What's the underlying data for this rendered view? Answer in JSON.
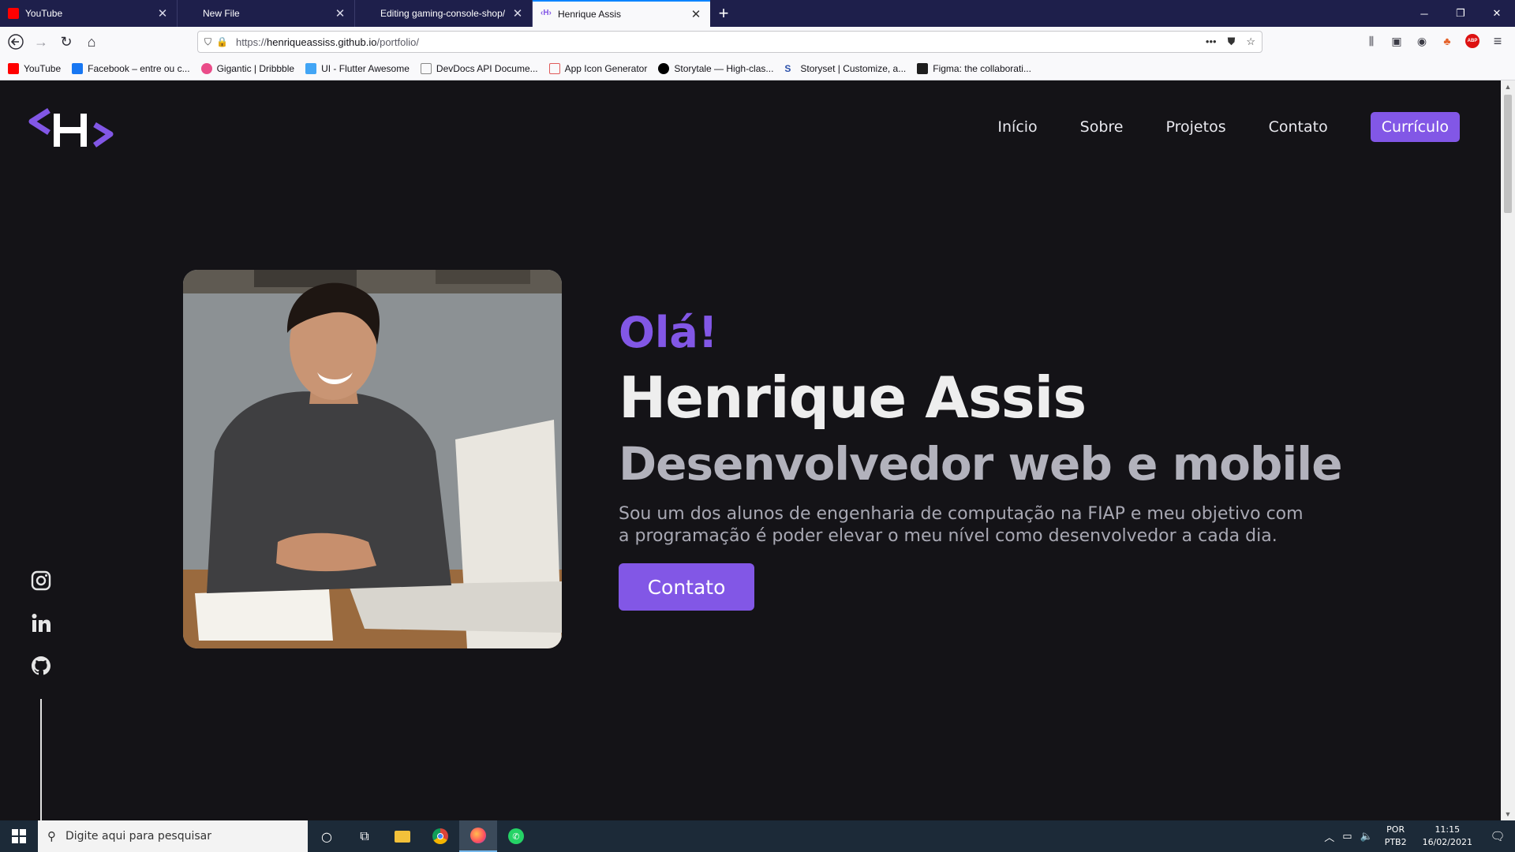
{
  "browser": {
    "tabs": [
      {
        "title": "YouTube",
        "favicon_color": "#ff0000",
        "active": false
      },
      {
        "title": "New File",
        "favicon_color": "",
        "active": false
      },
      {
        "title": "Editing gaming-console-shop/",
        "favicon_color": "",
        "active": false
      },
      {
        "title": "Henrique Assis",
        "favicon_color": "#8257e6",
        "active": true
      }
    ],
    "url_prefix": "https://",
    "url_host": "henriqueassiss.github.io",
    "url_path": "/portfolio/",
    "bookmarks": [
      {
        "label": "YouTube",
        "icon": "youtube-icon",
        "color": "#ff0000"
      },
      {
        "label": "Facebook – entre ou c...",
        "icon": "facebook-icon",
        "color": "#1877f2"
      },
      {
        "label": "Gigantic | Dribbble",
        "icon": "dribbble-icon",
        "color": "#ea4c89"
      },
      {
        "label": "UI - Flutter Awesome",
        "icon": "flutter-icon",
        "color": "#42a5f5"
      },
      {
        "label": "DevDocs API Docume...",
        "icon": "devdocs-icon",
        "color": "#888888"
      },
      {
        "label": "App Icon Generator",
        "icon": "app-icon-generator-icon",
        "color": "#e05a5a"
      },
      {
        "label": "Storytale — High-clas...",
        "icon": "storytale-icon",
        "color": "#000000"
      },
      {
        "label": "Storyset | Customize, a...",
        "icon": "storyset-icon",
        "color": "#2b50aa"
      },
      {
        "label": "Figma: the collaborati...",
        "icon": "figma-icon",
        "color": "#1e1e1e"
      }
    ]
  },
  "site": {
    "nav": {
      "inicio": "Início",
      "sobre": "Sobre",
      "projetos": "Projetos",
      "contato": "Contato",
      "curriculo": "Currículo"
    },
    "hero": {
      "greeting": "Olá!",
      "name": "Henrique Assis",
      "role": "Desenvolvedor web e mobile",
      "description": "Sou um dos alunos de engenharia de computação na FIAP e meu objetivo com a programação é poder elevar o meu nível como desenvolvedor a cada dia.",
      "cta": "Contato"
    },
    "accent_color": "#8257e6",
    "background_color": "#141317"
  },
  "taskbar": {
    "search_placeholder": "Digite aqui para pesquisar",
    "lang_top": "POR",
    "lang_bottom": "PTB2",
    "time": "11:15",
    "date": "16/02/2021"
  }
}
